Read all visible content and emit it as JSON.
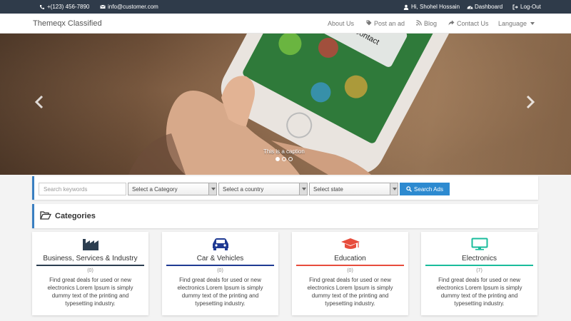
{
  "topbar": {
    "phone": "+(123) 456-7890",
    "email": "info@customer.com",
    "user": "Hi, Shohel Hossain",
    "dashboard": "Dashboard",
    "logout": "Log-Out"
  },
  "navbar": {
    "brand": "Themeqx Classified",
    "links": {
      "about": "About Us",
      "post_ad": "Post an ad",
      "blog": "Blog",
      "contact": "Contact Us",
      "language": "Language"
    }
  },
  "hero": {
    "caption": "This is a caption",
    "slides_total": 3,
    "active_slide": 1,
    "phone_menu_text": "Create New Contact"
  },
  "search": {
    "keywords_placeholder": "Search keywords",
    "category_select": "Select a Category",
    "country_select": "Select a country",
    "state_select": "Select state",
    "button_label": "Search Ads"
  },
  "categories": {
    "title": "Categories",
    "items": [
      {
        "name": "Business, Services & Industry",
        "count": "(0)",
        "description": "Find great deals for used or new electronics Lorem Ipsum is simply dummy text of the printing and typesetting industry.",
        "icon": "factory-icon",
        "color": "#2c3e50"
      },
      {
        "name": "Car & Vehicles",
        "count": "(0)",
        "description": "Find great deals for used or new electronics Lorem Ipsum is simply dummy text of the printing and typesetting industry.",
        "icon": "car-icon",
        "color": "#1f3a93"
      },
      {
        "name": "Education",
        "count": "(0)",
        "description": "Find great deals for used or new electronics Lorem Ipsum is simply dummy text of the printing and typesetting industry.",
        "icon": "graduation-cap-icon",
        "color": "#e74c3c"
      },
      {
        "name": "Electronics",
        "count": "(7)",
        "description": "Find great deals for used or new electronics Lorem Ipsum is simply dummy text of the printing and typesetting industry.",
        "icon": "monitor-icon",
        "color": "#1abc9c"
      }
    ]
  },
  "colors": {
    "topbar_bg": "#2f3b4a",
    "accent": "#3a7fc1",
    "search_button": "#2d8ad0"
  }
}
